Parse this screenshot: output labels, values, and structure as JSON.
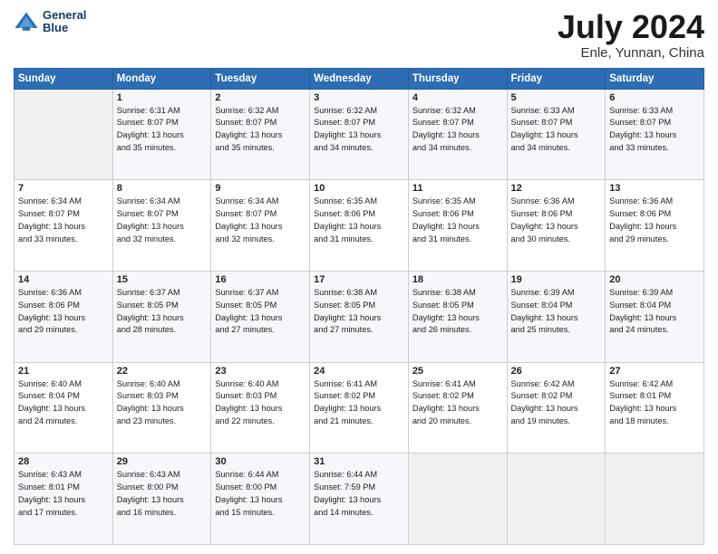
{
  "logo": {
    "line1": "General",
    "line2": "Blue"
  },
  "title": "July 2024",
  "subtitle": "Enle, Yunnan, China",
  "header": {
    "days": [
      "Sunday",
      "Monday",
      "Tuesday",
      "Wednesday",
      "Thursday",
      "Friday",
      "Saturday"
    ]
  },
  "weeks": [
    [
      {
        "day": "",
        "info": ""
      },
      {
        "day": "1",
        "info": "Sunrise: 6:31 AM\nSunset: 8:07 PM\nDaylight: 13 hours\nand 35 minutes."
      },
      {
        "day": "2",
        "info": "Sunrise: 6:32 AM\nSunset: 8:07 PM\nDaylight: 13 hours\nand 35 minutes."
      },
      {
        "day": "3",
        "info": "Sunrise: 6:32 AM\nSunset: 8:07 PM\nDaylight: 13 hours\nand 34 minutes."
      },
      {
        "day": "4",
        "info": "Sunrise: 6:32 AM\nSunset: 8:07 PM\nDaylight: 13 hours\nand 34 minutes."
      },
      {
        "day": "5",
        "info": "Sunrise: 6:33 AM\nSunset: 8:07 PM\nDaylight: 13 hours\nand 34 minutes."
      },
      {
        "day": "6",
        "info": "Sunrise: 6:33 AM\nSunset: 8:07 PM\nDaylight: 13 hours\nand 33 minutes."
      }
    ],
    [
      {
        "day": "7",
        "info": "Sunrise: 6:34 AM\nSunset: 8:07 PM\nDaylight: 13 hours\nand 33 minutes."
      },
      {
        "day": "8",
        "info": "Sunrise: 6:34 AM\nSunset: 8:07 PM\nDaylight: 13 hours\nand 32 minutes."
      },
      {
        "day": "9",
        "info": "Sunrise: 6:34 AM\nSunset: 8:07 PM\nDaylight: 13 hours\nand 32 minutes."
      },
      {
        "day": "10",
        "info": "Sunrise: 6:35 AM\nSunset: 8:06 PM\nDaylight: 13 hours\nand 31 minutes."
      },
      {
        "day": "11",
        "info": "Sunrise: 6:35 AM\nSunset: 8:06 PM\nDaylight: 13 hours\nand 31 minutes."
      },
      {
        "day": "12",
        "info": "Sunrise: 6:36 AM\nSunset: 8:06 PM\nDaylight: 13 hours\nand 30 minutes."
      },
      {
        "day": "13",
        "info": "Sunrise: 6:36 AM\nSunset: 8:06 PM\nDaylight: 13 hours\nand 29 minutes."
      }
    ],
    [
      {
        "day": "14",
        "info": "Sunrise: 6:36 AM\nSunset: 8:06 PM\nDaylight: 13 hours\nand 29 minutes."
      },
      {
        "day": "15",
        "info": "Sunrise: 6:37 AM\nSunset: 8:05 PM\nDaylight: 13 hours\nand 28 minutes."
      },
      {
        "day": "16",
        "info": "Sunrise: 6:37 AM\nSunset: 8:05 PM\nDaylight: 13 hours\nand 27 minutes."
      },
      {
        "day": "17",
        "info": "Sunrise: 6:38 AM\nSunset: 8:05 PM\nDaylight: 13 hours\nand 27 minutes."
      },
      {
        "day": "18",
        "info": "Sunrise: 6:38 AM\nSunset: 8:05 PM\nDaylight: 13 hours\nand 26 minutes."
      },
      {
        "day": "19",
        "info": "Sunrise: 6:39 AM\nSunset: 8:04 PM\nDaylight: 13 hours\nand 25 minutes."
      },
      {
        "day": "20",
        "info": "Sunrise: 6:39 AM\nSunset: 8:04 PM\nDaylight: 13 hours\nand 24 minutes."
      }
    ],
    [
      {
        "day": "21",
        "info": "Sunrise: 6:40 AM\nSunset: 8:04 PM\nDaylight: 13 hours\nand 24 minutes."
      },
      {
        "day": "22",
        "info": "Sunrise: 6:40 AM\nSunset: 8:03 PM\nDaylight: 13 hours\nand 23 minutes."
      },
      {
        "day": "23",
        "info": "Sunrise: 6:40 AM\nSunset: 8:03 PM\nDaylight: 13 hours\nand 22 minutes."
      },
      {
        "day": "24",
        "info": "Sunrise: 6:41 AM\nSunset: 8:02 PM\nDaylight: 13 hours\nand 21 minutes."
      },
      {
        "day": "25",
        "info": "Sunrise: 6:41 AM\nSunset: 8:02 PM\nDaylight: 13 hours\nand 20 minutes."
      },
      {
        "day": "26",
        "info": "Sunrise: 6:42 AM\nSunset: 8:02 PM\nDaylight: 13 hours\nand 19 minutes."
      },
      {
        "day": "27",
        "info": "Sunrise: 6:42 AM\nSunset: 8:01 PM\nDaylight: 13 hours\nand 18 minutes."
      }
    ],
    [
      {
        "day": "28",
        "info": "Sunrise: 6:43 AM\nSunset: 8:01 PM\nDaylight: 13 hours\nand 17 minutes."
      },
      {
        "day": "29",
        "info": "Sunrise: 6:43 AM\nSunset: 8:00 PM\nDaylight: 13 hours\nand 16 minutes."
      },
      {
        "day": "30",
        "info": "Sunrise: 6:44 AM\nSunset: 8:00 PM\nDaylight: 13 hours\nand 15 minutes."
      },
      {
        "day": "31",
        "info": "Sunrise: 6:44 AM\nSunset: 7:59 PM\nDaylight: 13 hours\nand 14 minutes."
      },
      {
        "day": "",
        "info": ""
      },
      {
        "day": "",
        "info": ""
      },
      {
        "day": "",
        "info": ""
      }
    ]
  ]
}
